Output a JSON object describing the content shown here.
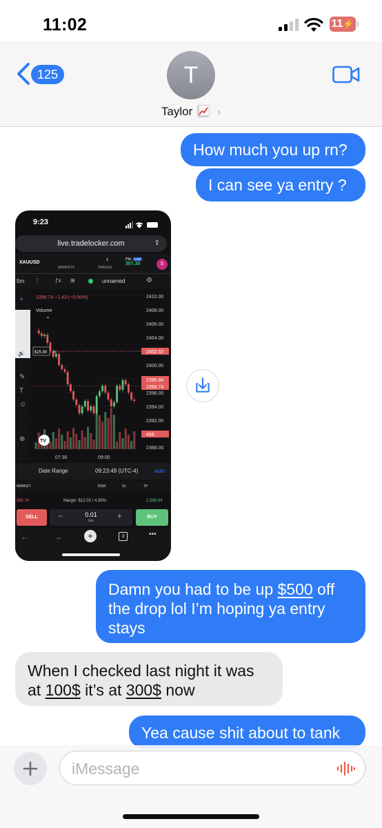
{
  "status_bar": {
    "time": "11:02",
    "battery": "11"
  },
  "header": {
    "back_count": "125",
    "avatar_initial": "T",
    "contact_name": "Taylor",
    "contact_emoji": "chart-increasing-emoji",
    "video_icon": "video-camera-icon"
  },
  "messages": {
    "m1": "How much you up rn?",
    "m2": "I can see ya entry ?",
    "m4_l1_a": "Damn you had to be up ",
    "m4_l1_link": "$500",
    "m4_l1_b": " off",
    "m4_l2": "the drop lol I’m hoping ya entry",
    "m4_l3": "stays",
    "m5_l1": "When I checked last night it was",
    "m5_l2_a": "at ",
    "m5_l2_link1": "100$",
    "m5_l2_b": " it’s at ",
    "m5_l2_link2": "300$",
    "m5_l2_c": " now",
    "m6": "Yea cause shit about to tank"
  },
  "screenshot": {
    "time": "9:23",
    "battery": "71",
    "url": "live.tradelocker.com",
    "symbol": "XAUUSD",
    "markets": "MARKETS",
    "trades": "TRADES",
    "trades_count": "3",
    "pl_label": "P&L",
    "live_label": "LIVE",
    "pl_value": "307.30",
    "user_initial": "S",
    "timeframe": "5m",
    "layout_name": "unnamed",
    "quote": "2396.74 −1.43 (−0.06%)",
    "volume_label": "Volume",
    "marker_price": "$25.90",
    "y_ticks": [
      "2410.00",
      "2408.00",
      "2406.00",
      "2404.00",
      "2402.02",
      "2400.00",
      "2396.84",
      "2396.74",
      "2396.00",
      "2394.00",
      "2392.00",
      "459",
      "2388.00"
    ],
    "x_ticks": [
      "07:30",
      "09:00"
    ],
    "date_range": "Date Range",
    "timestamp": "09:23:49 (UTC-4)",
    "auto": "auto",
    "market_tab": "MARKET",
    "risk": "RISK",
    "sl": "SL",
    "tp": "TP",
    "bid": ",396.74",
    "margin": "Margin: $12.02 / 4.35%",
    "ask": "2,396.84",
    "sell": "SELL",
    "lots_value": "0.01",
    "lots_label": "lots",
    "buy": "BUY",
    "tabs_count": "3"
  },
  "input": {
    "placeholder": "iMessage"
  },
  "colors": {
    "sent": "#2f7cf6",
    "received": "#e9e9eb",
    "sell": "#e35a5a",
    "buy": "#5fc27a"
  }
}
